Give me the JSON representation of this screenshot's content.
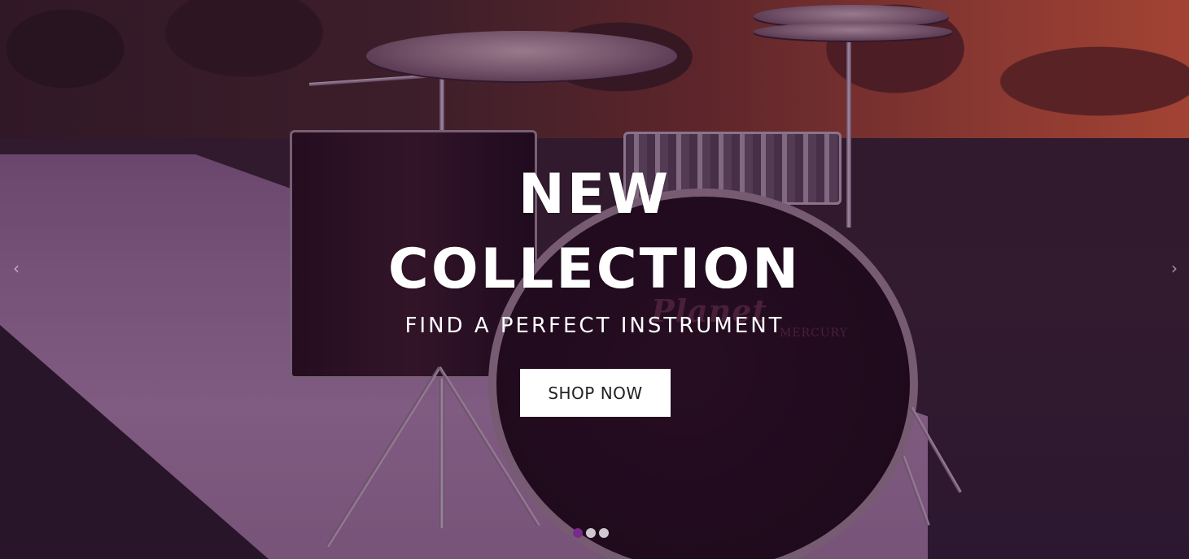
{
  "hero": {
    "headline_line1": "NEW",
    "headline_line2": "COLLECTION",
    "subtitle": "FIND A PERFECT INSTRUMENT",
    "cta_label": "SHOP NOW",
    "background_image_icon": "drum-kit-photo",
    "overlay_color": "#461446"
  },
  "carousel": {
    "prev_icon": "chevron-left-icon",
    "next_icon": "chevron-right-icon",
    "slide_count": 3,
    "active_slide": 1,
    "active_dot_color": "#7b2a8c",
    "inactive_dot_color": "#cfc8cf"
  },
  "bass_drum_logo": {
    "brand_text": "Planet",
    "model_text": "MERCURY"
  }
}
